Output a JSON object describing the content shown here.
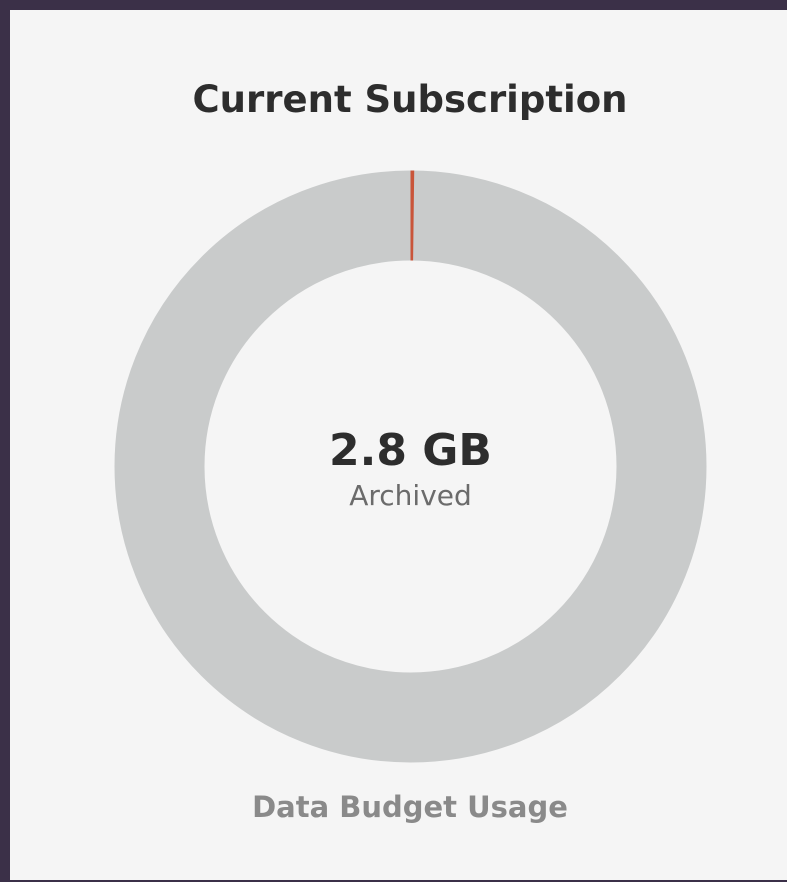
{
  "widget": {
    "title": "Current Subscription",
    "footer_label": "Data Budget Usage"
  },
  "usage": {
    "value": "2.8 GB",
    "label": "Archived"
  },
  "colors": {
    "ring_background": "#c9cbcb",
    "ring_used": "#c9553a",
    "panel_background": "#f5f5f5",
    "frame": "#3b3048"
  },
  "chart_data": {
    "type": "pie",
    "used_fraction": 0.002
  }
}
